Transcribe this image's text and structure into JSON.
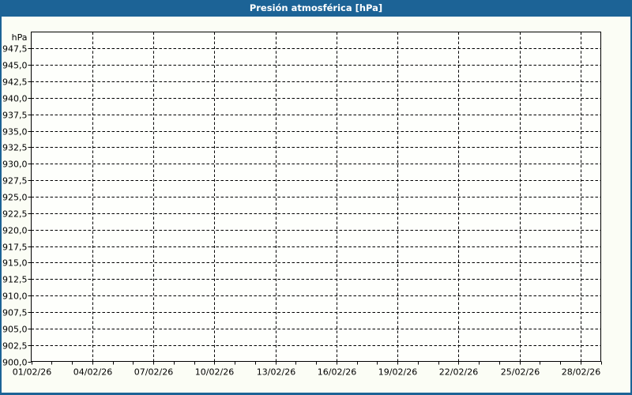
{
  "window": {
    "title": "Presión atmosférica [hPa]"
  },
  "colors": {
    "frame_blue": "#1c6396",
    "title_text": "#ffffff",
    "chart_background": "#fbfdf5",
    "plot_background": "#fefffc",
    "grid_line": "#000000",
    "axis_line": "#000000",
    "label_text": "#000000"
  },
  "chart_data": {
    "type": "line",
    "title": "Presión atmosférica [hPa]",
    "series": [],
    "grid": "dashed",
    "legend": "none",
    "y_axis": {
      "unit_label": "hPa",
      "min": 900,
      "max": 950,
      "grid_step": 2.5,
      "tick_labels": [
        "947,5",
        "945,0",
        "942,5",
        "940,0",
        "937,5",
        "935,0",
        "932,5",
        "930,0",
        "927,5",
        "925,0",
        "922,5",
        "920,0",
        "917,5",
        "915,0",
        "912,5",
        "910,0",
        "907,5",
        "905,0",
        "902,5",
        "900,0"
      ]
    },
    "x_axis": {
      "tick_labels": [
        "01/02/26",
        "04/02/26",
        "07/02/26",
        "10/02/26",
        "13/02/26",
        "16/02/26",
        "19/02/26",
        "22/02/26",
        "25/02/26",
        "28/02/26"
      ],
      "label_day_positions": [
        0,
        3,
        6,
        9,
        12,
        15,
        18,
        21,
        24,
        27
      ],
      "total_days": 28,
      "minor_tick_every_days": 1
    }
  }
}
